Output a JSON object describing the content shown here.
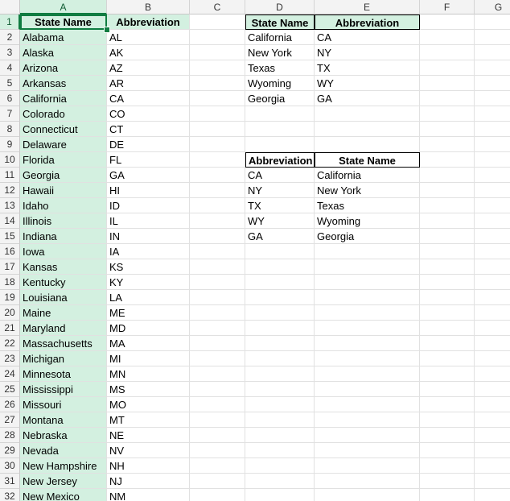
{
  "columns": [
    "A",
    "B",
    "C",
    "D",
    "E",
    "F",
    "G"
  ],
  "rows": [
    "1",
    "2",
    "3",
    "4",
    "5",
    "6",
    "7",
    "8",
    "9",
    "10",
    "11",
    "12",
    "13",
    "14",
    "15",
    "16",
    "17",
    "18",
    "19",
    "20",
    "21",
    "22",
    "23",
    "24",
    "25",
    "26",
    "27",
    "28",
    "29",
    "30",
    "31",
    "32"
  ],
  "main_table": {
    "header": [
      "State Name",
      "Abbreviation"
    ],
    "rows": [
      [
        "Alabama",
        "AL"
      ],
      [
        "Alaska",
        "AK"
      ],
      [
        "Arizona",
        "AZ"
      ],
      [
        "Arkansas",
        "AR"
      ],
      [
        "California",
        "CA"
      ],
      [
        "Colorado",
        "CO"
      ],
      [
        "Connecticut",
        "CT"
      ],
      [
        "Delaware",
        "DE"
      ],
      [
        "Florida",
        "FL"
      ],
      [
        "Georgia",
        "GA"
      ],
      [
        "Hawaii",
        "HI"
      ],
      [
        "Idaho",
        "ID"
      ],
      [
        "Illinois",
        "IL"
      ],
      [
        "Indiana",
        "IN"
      ],
      [
        "Iowa",
        "IA"
      ],
      [
        "Kansas",
        "KS"
      ],
      [
        "Kentucky",
        "KY"
      ],
      [
        "Louisiana",
        "LA"
      ],
      [
        "Maine",
        "ME"
      ],
      [
        "Maryland",
        "MD"
      ],
      [
        "Massachusetts",
        "MA"
      ],
      [
        "Michigan",
        "MI"
      ],
      [
        "Minnesota",
        "MN"
      ],
      [
        "Mississippi",
        "MS"
      ],
      [
        "Missouri",
        "MO"
      ],
      [
        "Montana",
        "MT"
      ],
      [
        "Nebraska",
        "NE"
      ],
      [
        "Nevada",
        "NV"
      ],
      [
        "New Hampshire",
        "NH"
      ],
      [
        "New Jersey",
        "NJ"
      ],
      [
        "New Mexico",
        "NM"
      ]
    ]
  },
  "lookup_table_1": {
    "header": [
      "State Name",
      "Abbreviation"
    ],
    "rows": [
      [
        "California",
        "CA"
      ],
      [
        "New York",
        "NY"
      ],
      [
        "Texas",
        "TX"
      ],
      [
        "Wyoming",
        "WY"
      ],
      [
        "Georgia",
        "GA"
      ]
    ]
  },
  "lookup_table_2": {
    "header": [
      "Abbreviation",
      "State Name"
    ],
    "rows": [
      [
        "CA",
        "California"
      ],
      [
        "NY",
        "New York"
      ],
      [
        "TX",
        "Texas"
      ],
      [
        "WY",
        "Wyoming"
      ],
      [
        "GA",
        "Georgia"
      ]
    ]
  },
  "colors": {
    "selection": "#d3f0e0",
    "accent": "#107c41"
  }
}
